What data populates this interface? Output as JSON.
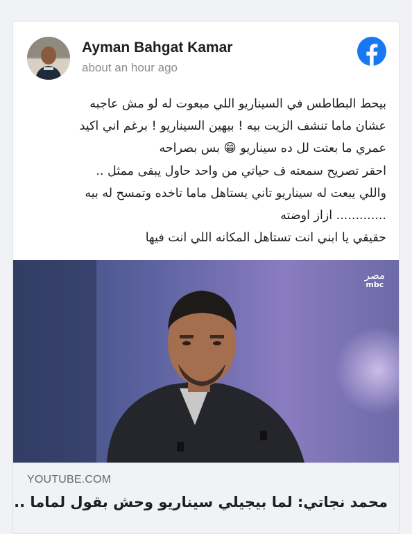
{
  "post": {
    "author": "Ayman Bahgat Kamar",
    "timestamp": "about an hour ago",
    "text_lines": [
      "بيحط البطاطس في السيناريو اللي مبعوت له لو مش عاجبه",
      "عشان ماما تنشف الزيت بيه ! بيهين السيناريو ! برغم اني اكيد",
      "عمري ما بعتت لل ده سيناريو 😁 بس بصراحه",
      "احقر تصريح سمعته ف حياتي من واحد حاول يبقى ممثل ..",
      "واللي يبعت له سيناريو تاني يستاهل ماما تاخده وتمسح له بيه",
      "............. ازاز اوضته",
      "حقيقي يا ابني انت تستاهل المكانه اللي انت فيها"
    ]
  },
  "icons": {
    "facebook": "facebook-logo-icon",
    "avatar": "author-avatar"
  },
  "media": {
    "channel_arabic": "مصر",
    "channel_latin": "mbc"
  },
  "link_preview": {
    "source": "YOUTUBE.COM",
    "title": "محمد نجاتي: لما بيجيلي سيناريو وحش بقول لماما ..."
  },
  "colors": {
    "facebook_blue": "#1877f2",
    "text_primary": "#1c1e21",
    "text_secondary": "#8a8d91"
  }
}
